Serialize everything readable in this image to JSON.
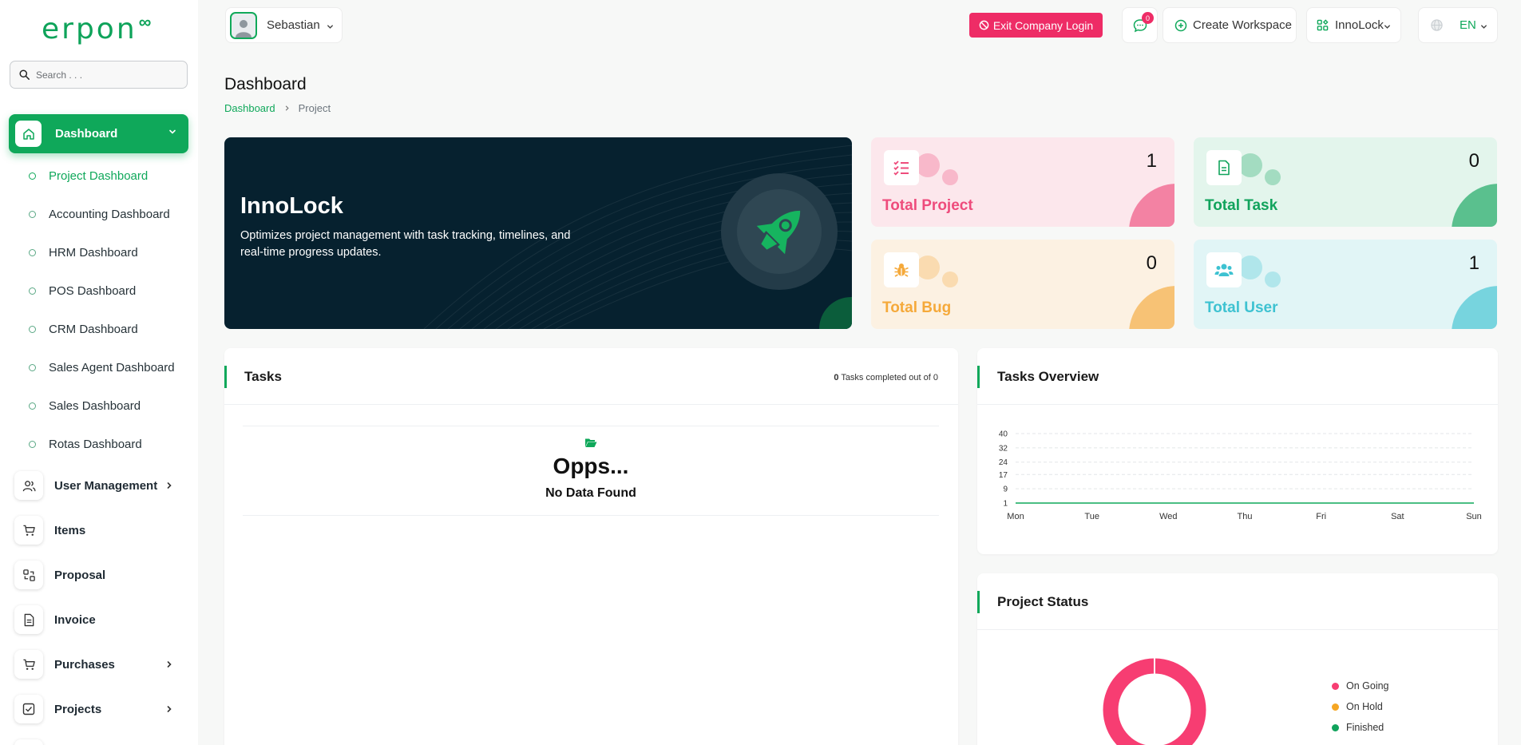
{
  "brand": {
    "logo_text": "erpon",
    "logo_suffix": "∞"
  },
  "sidebar": {
    "search_placeholder": "Search . . .",
    "active_item": {
      "label": "Dashboard"
    },
    "sub_items": [
      {
        "label": "Project Dashboard",
        "current": true
      },
      {
        "label": "Accounting Dashboard"
      },
      {
        "label": "HRM Dashboard"
      },
      {
        "label": "POS Dashboard"
      },
      {
        "label": "CRM Dashboard"
      },
      {
        "label": "Sales Agent Dashboard"
      },
      {
        "label": "Sales Dashboard"
      },
      {
        "label": "Rotas Dashboard"
      }
    ],
    "items": [
      {
        "label": "User Management",
        "icon": "users-icon",
        "has_children": true
      },
      {
        "label": "Items",
        "icon": "cart-icon",
        "has_children": false
      },
      {
        "label": "Proposal",
        "icon": "proposal-icon",
        "has_children": false
      },
      {
        "label": "Invoice",
        "icon": "invoice-icon",
        "has_children": false
      },
      {
        "label": "Purchases",
        "icon": "cart-icon",
        "has_children": true
      },
      {
        "label": "Projects",
        "icon": "checkbox-icon",
        "has_children": true
      }
    ]
  },
  "topbar": {
    "user_name": "Sebastian",
    "exit_label": "Exit Company Login",
    "messages_badge": "0",
    "create_workspace_label": "Create Workspace",
    "workspace_label": "InnoLock",
    "language_label": "EN"
  },
  "page": {
    "title": "Dashboard",
    "breadcrumb": [
      "Dashboard",
      "Project"
    ]
  },
  "banner": {
    "title": "InnoLock",
    "description": "Optimizes project management with task tracking, timelines, and real-time progress updates."
  },
  "stats": [
    {
      "label": "Total Project",
      "value": "1",
      "color": "#ee4c7c",
      "bg": "#fce7ec"
    },
    {
      "label": "Total Task",
      "value": "0",
      "color": "#11a35c",
      "bg": "#e3f5ec"
    },
    {
      "label": "Total Bug",
      "value": "0",
      "color": "#f5a93a",
      "bg": "#fcf1e2"
    },
    {
      "label": "Total User",
      "value": "1",
      "color": "#3ec2d1",
      "bg": "#e1f5f6"
    }
  ],
  "tasks_panel": {
    "title": "Tasks",
    "completed_count": "0",
    "completed_text": "Tasks completed out of 0",
    "empty_title": "Opps...",
    "empty_subtitle": "No Data Found"
  },
  "overview_panel": {
    "title": "Tasks Overview"
  },
  "status_panel": {
    "title": "Project Status"
  },
  "chart_data": [
    {
      "type": "line",
      "title": "Tasks Overview",
      "categories": [
        "Mon",
        "Tue",
        "Wed",
        "Thu",
        "Fri",
        "Sat",
        "Sun"
      ],
      "y_ticks": [
        1,
        9,
        17,
        24,
        32,
        40
      ],
      "ylim": [
        1,
        40
      ],
      "series": [
        {
          "values": [
            0,
            0,
            0,
            0,
            0,
            0,
            0
          ]
        }
      ],
      "grid": true
    },
    {
      "type": "pie",
      "title": "Project Status",
      "donut": true,
      "slices": [
        {
          "label": "On Going",
          "value": 1,
          "color": "#f73d72"
        },
        {
          "label": "On Hold",
          "value": 0,
          "color": "#f5a623"
        },
        {
          "label": "Finished",
          "value": 0,
          "color": "#11a35c"
        }
      ],
      "legend": "right"
    }
  ]
}
